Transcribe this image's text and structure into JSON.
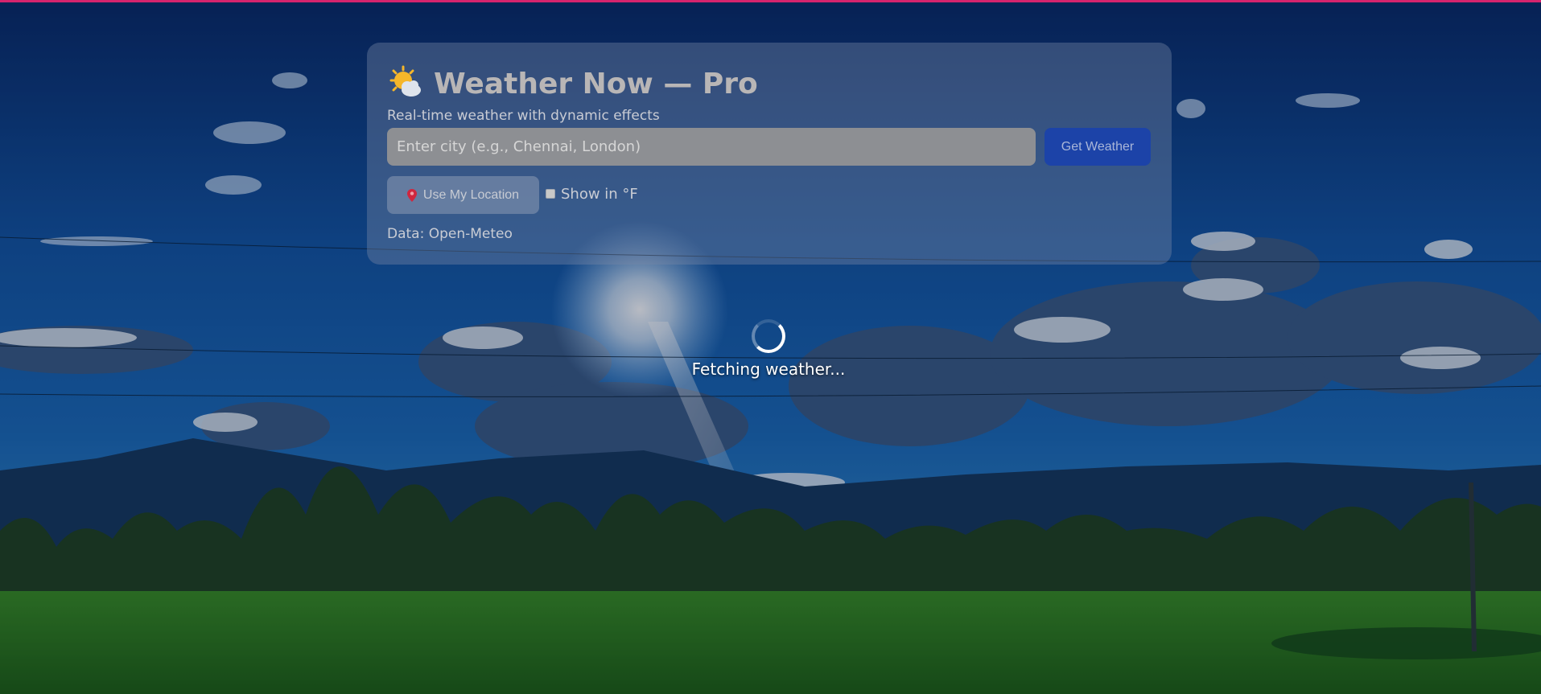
{
  "app": {
    "title": "Weather Now — Pro",
    "subtitle": "Real-time weather with dynamic effects",
    "title_icon": "sun-behind-cloud-icon"
  },
  "search": {
    "placeholder": "Enter city (e.g., Chennai, London)",
    "value": "",
    "button_label": "Get Weather"
  },
  "options": {
    "location_button_label": "Use My Location",
    "location_icon": "pin-icon",
    "fahrenheit_label": "Show in °F",
    "fahrenheit_checked": false
  },
  "footer": {
    "data_source": "Data: Open-Meteo"
  },
  "loading": {
    "text": "Fetching weather..."
  },
  "colors": {
    "accent_strip": "#d6246e",
    "primary_button": "#1c43a8",
    "sky_top": "#0d2f6e",
    "grass": "#3f9a2c"
  }
}
